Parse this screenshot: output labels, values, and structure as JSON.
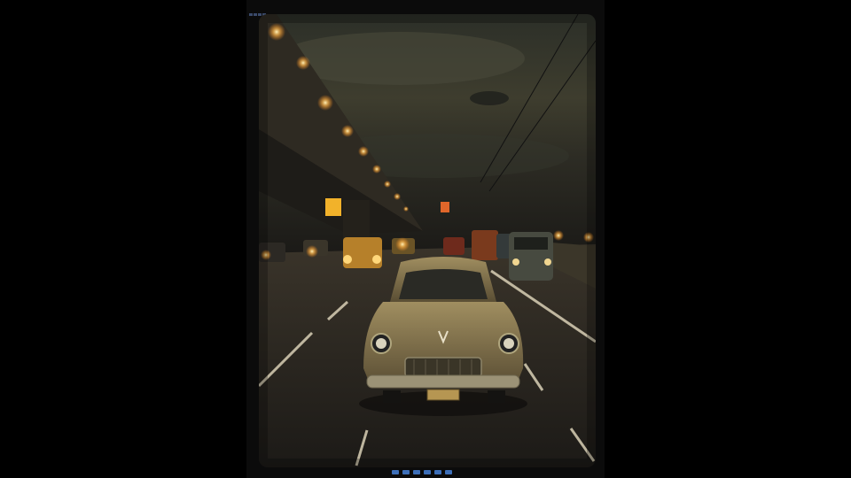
{
  "scene": {
    "description_free": true,
    "colors": {
      "background": "#000000",
      "frame": "#0b0b0b",
      "sky_top": "#2b2f27",
      "sky_mid": "#4a4a36",
      "sky_horizon": "#6b5c3a",
      "road": "#2a2722",
      "car_body": "#8a7a52",
      "light_glow": "#ffb347"
    },
    "icons": [
      "top-left-status-icon",
      "bottom-indicator-icon"
    ]
  }
}
